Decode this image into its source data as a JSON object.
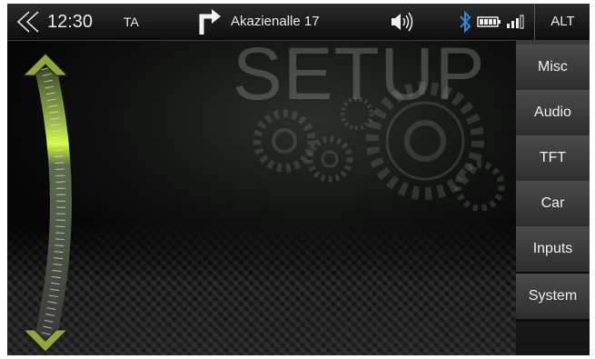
{
  "status_bar": {
    "back_icon": "double-chevron-left-icon",
    "time": "12:30",
    "ta_label": "TA",
    "navigation_icon": "turn-right-arrow-icon",
    "street": "Akazienalle 17",
    "volume_icon": "speaker-icon",
    "bluetooth_icon": "bluetooth-icon",
    "battery_icon": "battery-icon",
    "signal_icon": "signal-bars-icon",
    "alt_label": "ALT"
  },
  "main": {
    "title": "SETUP",
    "slider_icons": [
      "arrow-up-icon",
      "arrow-down-icon"
    ]
  },
  "menu": {
    "items": [
      {
        "label": "Misc"
      },
      {
        "label": "Audio"
      },
      {
        "label": "TFT"
      },
      {
        "label": "Car"
      },
      {
        "label": "Inputs"
      },
      {
        "label": "System"
      }
    ]
  },
  "colors": {
    "accent_green": "#b4e61e",
    "bluetooth_blue": "#2a8fe0"
  }
}
